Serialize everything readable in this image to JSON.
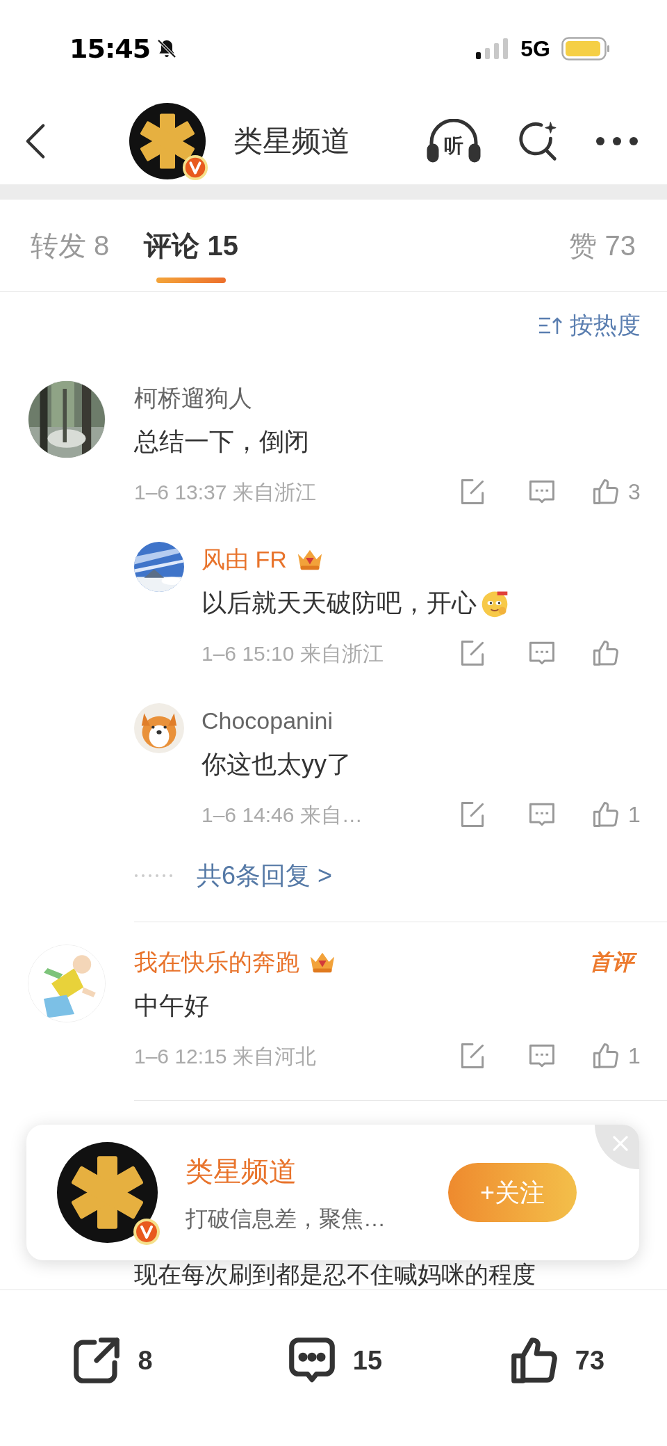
{
  "status_bar": {
    "time": "15:45",
    "network": "5G"
  },
  "header": {
    "title": "类星频道",
    "listen_label": "听"
  },
  "tabs": [
    {
      "label": "转发 8",
      "selected": false
    },
    {
      "label": "评论 15",
      "selected": true
    },
    {
      "label": "赞 73",
      "selected": false
    }
  ],
  "sort": {
    "label": "按热度"
  },
  "comments": [
    {
      "author": "柯桥遛狗人",
      "vip": false,
      "text": "总结一下，倒闭",
      "time": "1–6 13:37",
      "location": "来自浙江",
      "likes": "3",
      "replies": [
        {
          "author": "风由 FR",
          "vip": true,
          "text": "以后就天天破防吧，开心",
          "sticker": true,
          "time": "1–6 15:10",
          "location": "来自浙江"
        },
        {
          "author": "Chocopanini",
          "vip": false,
          "text": "你这也太yy了",
          "sticker": false,
          "time": "1–6 14:46",
          "location": "来自…",
          "likes": "1"
        }
      ],
      "more_replies": "共6条回复 >"
    },
    {
      "author": "我在快乐的奔跑",
      "vip": true,
      "badge": "首评",
      "text": "中午好",
      "time": "1–6 12:15",
      "location": "来自河北",
      "likes": "1"
    }
  ],
  "obscured_comment": {
    "text": "现在每次刷到都是忍不住喊妈咪的程度"
  },
  "follow_popup": {
    "name": "类星频道",
    "description": "打破信息差，聚焦…",
    "follow_button": "+关注"
  },
  "bottom_bar": [
    {
      "kind": "repost",
      "count": "8"
    },
    {
      "kind": "comment",
      "count": "15"
    },
    {
      "kind": "like",
      "count": "73"
    }
  ]
}
